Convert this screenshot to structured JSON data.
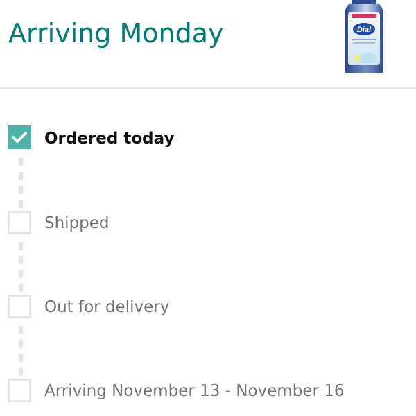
{
  "header": {
    "title": "Arriving Monday",
    "product_logo_text": "Dial"
  },
  "steps": [
    {
      "label": "Ordered today",
      "done": true
    },
    {
      "label": "Shipped",
      "done": false
    },
    {
      "label": "Out for delivery",
      "done": false
    },
    {
      "label": "Arriving November 13 - November 16",
      "done": false
    }
  ],
  "colors": {
    "accent_teal": "#007a72",
    "check_fill": "#4fb4a8",
    "inactive_gray": "#e3e6e6",
    "text_dark": "#0f1111",
    "text_gray": "#6f7373"
  },
  "icons": {
    "done_step": "checkmark-icon",
    "pending_step": "empty-checkbox-icon",
    "product": "soap-bottle-image"
  }
}
